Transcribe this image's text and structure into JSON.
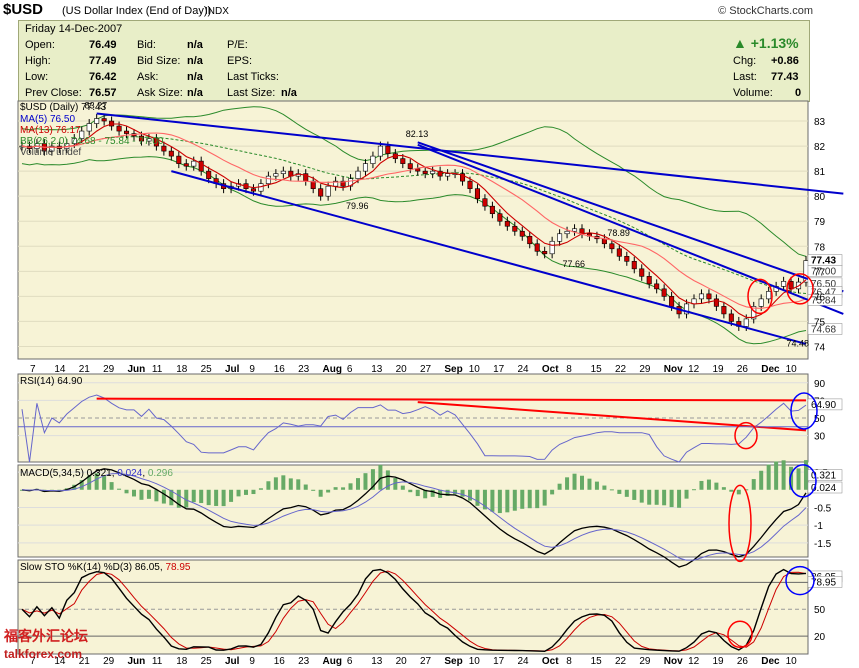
{
  "header": {
    "symbol": "$USD",
    "description": "(US Dollar Index (End of Day))",
    "exchange": "INDX",
    "brand": "© StockCharts.com"
  },
  "quote": {
    "date": "Friday  14-Dec-2007",
    "open_label": "Open:",
    "open": "76.49",
    "high_label": "High:",
    "high": "77.49",
    "low_label": "Low:",
    "low": "76.42",
    "prev_label": "Prev Close:",
    "prev": "76.57",
    "bid_label": "Bid:",
    "bid": "n/a",
    "bidsize_label": "Bid Size:",
    "bidsize": "n/a",
    "ask_label": "Ask:",
    "ask": "n/a",
    "asksize_label": "Ask Size:",
    "asksize": "n/a",
    "pe_label": "P/E:",
    "eps_label": "EPS:",
    "lastticks_label": "Last Ticks:",
    "lastsize_label": "Last Size:",
    "lastsize": "n/a",
    "chg_pct": "▲ +1.13%",
    "chg_label": "Chg:",
    "chg": "+0.86",
    "last_label": "Last:",
    "last": "77.43",
    "volume_label": "Volume:",
    "volume": "0"
  },
  "legends": {
    "price": "$USD (Daily) 77.43",
    "ma5": "MA(5) 76.50",
    "ma13": "MA(13) 76.17",
    "bb": "BB(26,2.0) 74.68 - 75.84 - 77.00",
    "vol": "Volume undef",
    "rsi": "RSI(14) 64.90",
    "macd_a": "MACD(5,34,5) 0.321,",
    "macd_b": "0.024",
    "macd_c": "0.296",
    "sto_a": "Slow STO %K(14) %D(3) 86.05,",
    "sto_b": "78.95"
  },
  "colors": {
    "price_line": "#0000cc",
    "ma5": "#cc0000",
    "ma13": "#ff6666",
    "bb": "#2a8a2a",
    "trendline": "#0000cc",
    "rsi_line": "#6666cc",
    "macd_hist": "#66aa66",
    "highlight_red": "#ff0000",
    "highlight_blue": "#0000ff"
  },
  "chart_data": [
    {
      "type": "candlestick",
      "title": "$USD (Daily) 77.43",
      "ylim": [
        73.5,
        83.8
      ],
      "y_ticks": [
        74,
        75,
        76,
        77,
        78,
        79,
        80,
        81,
        82,
        83
      ],
      "x_ticks": [
        "7",
        "14",
        "21",
        "29",
        "Jun",
        "11",
        "18",
        "25",
        "Jul",
        "9",
        "16",
        "23",
        "Aug",
        "6",
        "13",
        "20",
        "27",
        "Sep",
        "10",
        "17",
        "24",
        "Oct",
        "8",
        "15",
        "22",
        "29",
        "Nov",
        "12",
        "19",
        "26",
        "Dec",
        "10"
      ],
      "annotations": [
        {
          "label": "83.27",
          "date_index": 10,
          "value": 83.27
        },
        {
          "label": "82.13",
          "date_index": 53,
          "value": 82.13
        },
        {
          "label": "79.96",
          "date_index": 45,
          "value": 79.96
        },
        {
          "label": "78.89",
          "date_index": 80,
          "value": 78.89
        },
        {
          "label": "77.66",
          "date_index": 74,
          "value": 77.66
        },
        {
          "label": "74.48",
          "date_index": 104,
          "value": 74.48
        }
      ],
      "right_labels": [
        "77.43",
        "77.00",
        "76.50",
        "76.47",
        "75.84",
        "74.68"
      ],
      "series": [
        {
          "name": "$USD",
          "close": [
            82.0,
            81.9,
            82.1,
            81.8,
            82.0,
            81.9,
            82.1,
            82.3,
            82.6,
            82.9,
            83.1,
            83.0,
            82.8,
            82.6,
            82.5,
            82.4,
            82.2,
            82.3,
            82.0,
            81.8,
            81.6,
            81.3,
            81.2,
            81.4,
            81.0,
            80.7,
            80.5,
            80.3,
            80.4,
            80.5,
            80.3,
            80.2,
            80.5,
            80.8,
            80.9,
            81.0,
            80.8,
            80.9,
            80.6,
            80.3,
            80.0,
            80.4,
            80.6,
            80.4,
            80.7,
            81.0,
            81.3,
            81.6,
            82.0,
            81.7,
            81.5,
            81.3,
            81.1,
            81.0,
            80.9,
            81.0,
            80.8,
            80.9,
            80.9,
            80.6,
            80.3,
            79.9,
            79.6,
            79.3,
            79.0,
            78.8,
            78.6,
            78.4,
            78.1,
            77.8,
            77.7,
            78.2,
            78.5,
            78.6,
            78.7,
            78.5,
            78.4,
            78.3,
            78.1,
            77.9,
            77.6,
            77.4,
            77.1,
            76.8,
            76.5,
            76.3,
            76.0,
            75.6,
            75.3,
            75.7,
            75.9,
            76.1,
            75.9,
            75.6,
            75.3,
            75.0,
            74.8,
            75.1,
            75.6,
            75.9,
            76.2,
            76.4,
            76.6,
            76.3,
            76.57,
            77.43
          ]
        },
        {
          "name": "MA(5)",
          "value_last": 76.5
        },
        {
          "name": "MA(13)",
          "value_last": 76.17
        },
        {
          "name": "BB upper",
          "value_last": 77.0
        },
        {
          "name": "BB middle",
          "value_last": 75.84
        },
        {
          "name": "BB lower",
          "value_last": 74.68
        }
      ]
    },
    {
      "type": "line",
      "title": "RSI(14) 64.90",
      "ylim": [
        0,
        100
      ],
      "y_ticks": [
        30,
        50,
        70,
        90
      ],
      "series": [
        {
          "name": "RSI(14)",
          "value_last": 64.9
        }
      ]
    },
    {
      "type": "line",
      "title": "MACD(5,34,5) 0.321, 0.024, 0.296",
      "ylim": [
        -1.9,
        0.7
      ],
      "y_ticks": [
        0.5,
        -0.5,
        -1.0,
        -1.5
      ],
      "series": [
        {
          "name": "MACD",
          "value_last": 0.321
        },
        {
          "name": "Signal",
          "value_last": 0.024
        },
        {
          "name": "Histogram",
          "value_last": 0.296
        }
      ]
    },
    {
      "type": "line",
      "title": "Slow STO %K(14) %D(3) 86.05, 78.95",
      "ylim": [
        0,
        105
      ],
      "y_ticks": [
        20,
        50,
        80
      ],
      "series": [
        {
          "name": "%K",
          "value_last": 86.05
        },
        {
          "name": "%D",
          "value_last": 78.95
        }
      ]
    }
  ],
  "watermark": {
    "line1": "福客外汇论坛",
    "line2": "talkforex.com"
  }
}
